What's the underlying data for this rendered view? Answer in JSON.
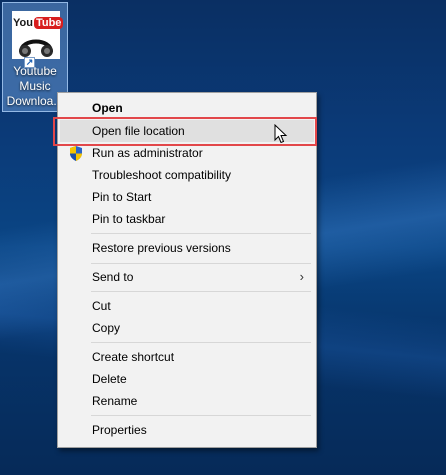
{
  "desktop": {
    "shortcut": {
      "icon": "youtube-music-downloader-icon",
      "label_lines": [
        "Youtube",
        "Music",
        "Downloa..."
      ],
      "logo_you": "You",
      "logo_tube": "Tube"
    }
  },
  "context_menu": {
    "items": [
      {
        "label": "Open",
        "bold": true
      },
      {
        "label": "Open file location",
        "highlighted": true
      },
      {
        "label": "Run as administrator",
        "icon": "shield-icon"
      },
      {
        "label": "Troubleshoot compatibility"
      },
      {
        "label": "Pin to Start"
      },
      {
        "label": "Pin to taskbar"
      },
      {
        "label": "Restore previous versions"
      },
      {
        "label": "Send to",
        "submenu": true
      },
      {
        "label": "Cut"
      },
      {
        "label": "Copy"
      },
      {
        "label": "Create shortcut"
      },
      {
        "label": "Delete"
      },
      {
        "label": "Rename"
      },
      {
        "label": "Properties"
      }
    ],
    "submenu_arrow": "›"
  },
  "colors": {
    "desktop_bg": "#0a3f7e",
    "menu_bg": "#f2f2f2",
    "hover_bg": "#e0e0e0",
    "annotation_red": "#e2474a"
  }
}
